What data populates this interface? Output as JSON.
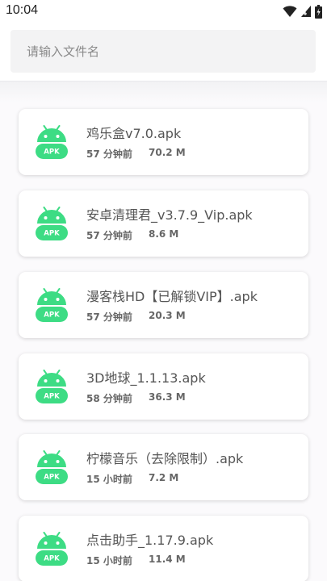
{
  "status_bar": {
    "time": "10:04",
    "icons": [
      "wifi-icon",
      "signal-icon",
      "battery-icon"
    ]
  },
  "search": {
    "placeholder": "请输入文件名",
    "value": ""
  },
  "colors": {
    "accent": "#3ddc84",
    "icon_label": "#ffffff"
  },
  "files": [
    {
      "name": "鸡乐盒v7.0.apk",
      "time": "57 分钟前",
      "size": "70.2 M",
      "icon_label": "APK"
    },
    {
      "name": "安卓清理君_v3.7.9_Vip.apk",
      "time": "57 分钟前",
      "size": "8.6 M",
      "icon_label": "APK"
    },
    {
      "name": "漫客栈HD【已解锁VIP】.apk",
      "time": "57 分钟前",
      "size": "20.3 M",
      "icon_label": "APK"
    },
    {
      "name": "3D地球_1.1.13.apk",
      "time": "58 分钟前",
      "size": "36.3 M",
      "icon_label": "APK"
    },
    {
      "name": "柠檬音乐（去除限制）.apk",
      "time": "15 小时前",
      "size": "7.2 M",
      "icon_label": "APK"
    },
    {
      "name": "点击助手_1.17.9.apk",
      "time": "15 小时前",
      "size": "11.4 M",
      "icon_label": "APK"
    }
  ]
}
